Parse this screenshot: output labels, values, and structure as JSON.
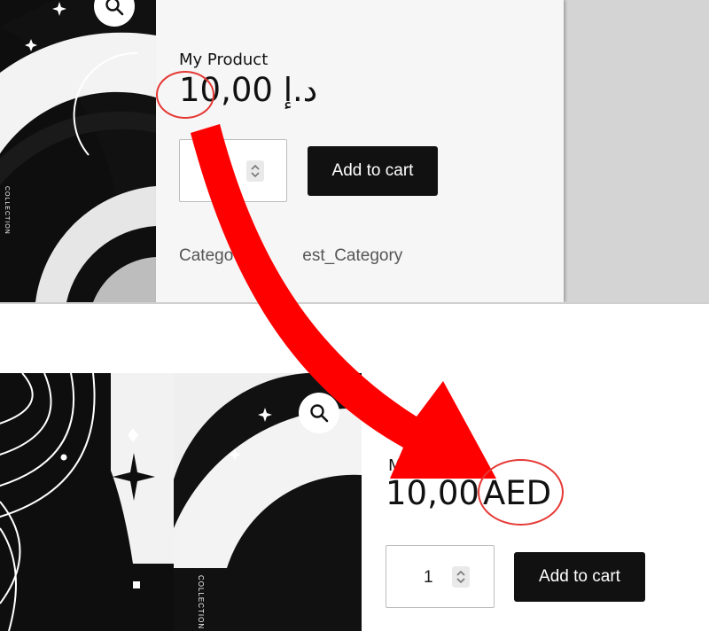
{
  "before": {
    "title": "My Product",
    "currency_symbol": "د.إ",
    "amount": "10,00",
    "quantity": "",
    "add_to_cart_label": "Add to cart",
    "category_prefix": "Catego",
    "category_suffix": "est_Category"
  },
  "after": {
    "title": "My Product",
    "amount": "10,00",
    "currency_code": "AED",
    "quantity": "1",
    "add_to_cart_label": "Add to cart"
  },
  "image_lettering": "COLLECTION",
  "icons": [
    "search-icon",
    "spinner-arrows-icon",
    "annotation-arrow-icon",
    "annotation-circle"
  ],
  "colors": {
    "annotation": "#e53935",
    "button": "#111111",
    "card": "#f6f6f6"
  }
}
